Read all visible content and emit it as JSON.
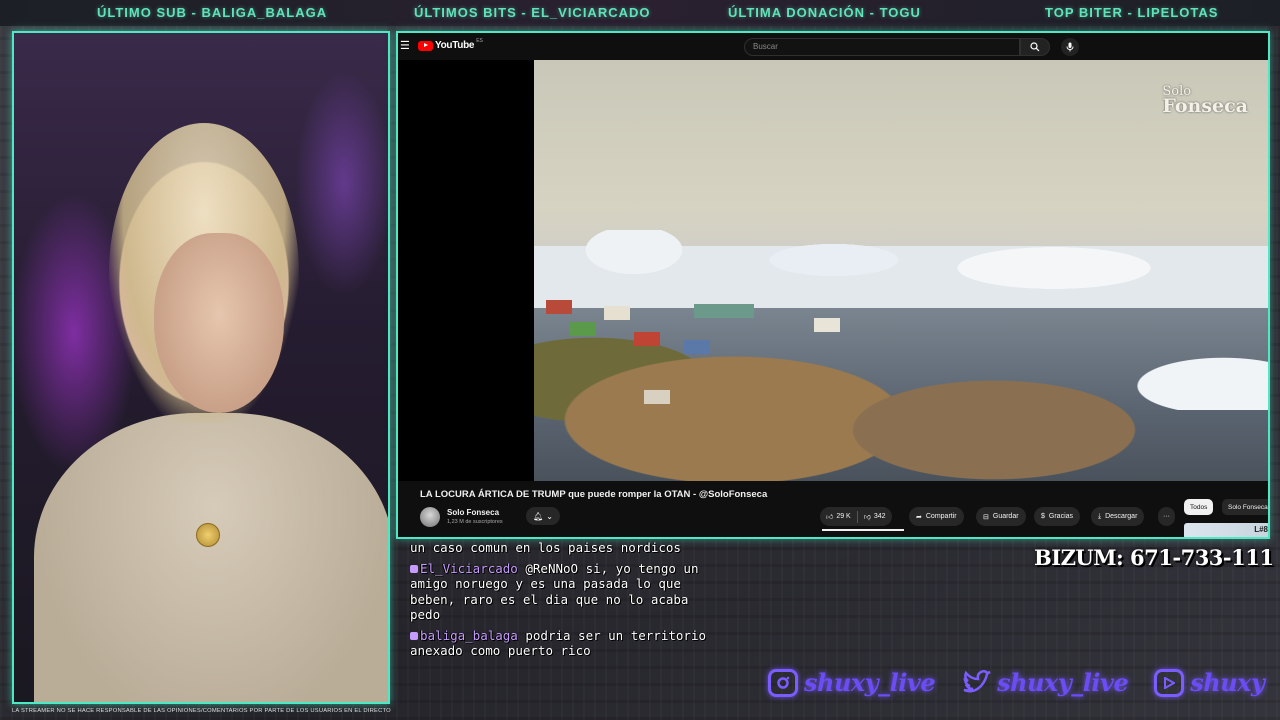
{
  "ticker": {
    "last_sub": "ÚLTIMO SUB - BALIGA_BALAGA",
    "last_bits": "ÚLTIMOS BITS - EL_VICIARCADO",
    "last_donation": "ÚLTIMA DONACIÓN - TOGU",
    "top_biter": "TOP BITER - LIPELOTAS"
  },
  "youtube": {
    "logo_text": "YouTube",
    "logo_country": "ES",
    "search_placeholder": "Buscar",
    "watermark_line1": "Solo",
    "watermark_line2": "Fonseca",
    "video_title": "LA LOCURA ÁRTICA DE TRUMP que puede romper la OTAN - @SoloFonseca",
    "channel_name": "Solo Fonseca",
    "channel_subs": "1,23 M de suscriptores",
    "likes": "29 K",
    "dislikes": "342",
    "share_label": "Compartir",
    "save_label": "Guardar",
    "thanks_label": "Gracias",
    "download_label": "Descargar",
    "more_label": "···",
    "chip_all": "Todos",
    "chip_channel": "Solo Fonseca",
    "thumb_text": "L#8"
  },
  "chat": {
    "messages": [
      {
        "user": "",
        "text": "un caso comun en los paises nordicos"
      },
      {
        "user": "El_Viciarcado",
        "text": "@ReNNoO si, yo tengo un amigo noruego y es una pasada lo que beben, raro es el dia que no lo acaba pedo"
      },
      {
        "user": "baliga_balaga",
        "text": "podria ser un territorio anexado como puerto rico"
      }
    ]
  },
  "bizum": "BIZUM: 671-733-111",
  "socials": [
    {
      "icon": "instagram-icon",
      "handle": "shuxy_live"
    },
    {
      "icon": "twitter-icon",
      "handle": "shuxy_live"
    },
    {
      "icon": "youtube-icon",
      "handle": "shuxy"
    }
  ],
  "disclaimer": "LA STREAMER NO SE HACE RESPONSABLE DE LAS OPINIONES/COMENTARIOS POR PARTE DE LOS USUARIOS EN EL DIRECTO",
  "colors": {
    "accent_teal": "#4de8c4",
    "ticker_text": "#5fe3b8",
    "social_purple": "#6b4cf5",
    "chat_user": "#c79cff",
    "youtube_red": "#ff0000"
  }
}
